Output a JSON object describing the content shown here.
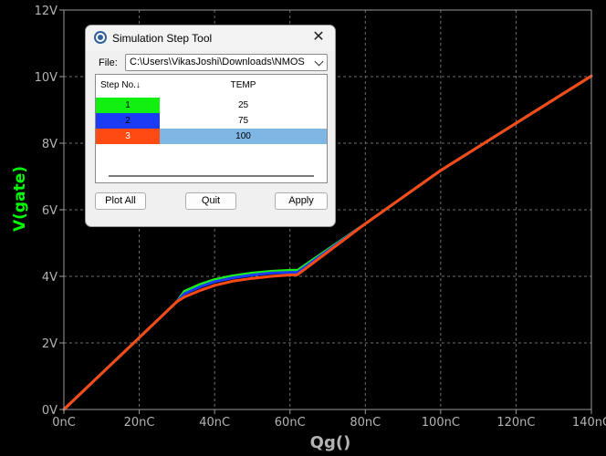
{
  "chart_data": {
    "type": "line",
    "title": "",
    "xlabel": "Qg()",
    "ylabel": "V(gate)",
    "xlim": [
      0,
      140
    ],
    "ylim": [
      0,
      12
    ],
    "x_ticks": [
      "0nC",
      "20nC",
      "40nC",
      "60nC",
      "80nC",
      "100nC",
      "120nC",
      "140nC"
    ],
    "y_ticks": [
      "0V",
      "2V",
      "4V",
      "6V",
      "8V",
      "10V",
      "12V"
    ],
    "x_tick_values": [
      0,
      20,
      40,
      60,
      80,
      100,
      120,
      140
    ],
    "y_tick_values": [
      0,
      2,
      4,
      6,
      8,
      10,
      12
    ],
    "grid": true,
    "series": [
      {
        "color": "#1cf01c",
        "x": [
          0,
          10,
          20,
          30,
          32,
          36,
          40,
          45,
          50,
          55,
          60,
          62,
          80,
          100,
          120,
          140
        ],
        "y": [
          0,
          1.08,
          2.16,
          3.24,
          3.55,
          3.75,
          3.9,
          4.02,
          4.1,
          4.15,
          4.18,
          4.18,
          5.58,
          7.18,
          8.6,
          10.02
        ]
      },
      {
        "color": "#1a3cf5",
        "x": [
          0,
          10,
          20,
          30,
          32,
          36,
          40,
          45,
          50,
          55,
          60,
          62,
          80,
          100,
          120,
          140
        ],
        "y": [
          0,
          1.08,
          2.16,
          3.24,
          3.48,
          3.68,
          3.84,
          3.96,
          4.04,
          4.1,
          4.12,
          4.12,
          5.58,
          7.18,
          8.6,
          10.02
        ]
      },
      {
        "color": "#ff4a14",
        "x": [
          0,
          10,
          20,
          30,
          32,
          36,
          40,
          45,
          50,
          55,
          60,
          62,
          80,
          100,
          120,
          140
        ],
        "y": [
          0,
          1.08,
          2.16,
          3.24,
          3.38,
          3.57,
          3.73,
          3.86,
          3.94,
          4.0,
          4.04,
          4.05,
          5.58,
          7.18,
          8.6,
          10.02
        ]
      }
    ]
  },
  "dialog": {
    "title": "Simulation Step Tool",
    "file_label": "File:",
    "file_value": "C:\\Users\\VikasJoshi\\Downloads\\NMOS Vgs vs Qg",
    "table": {
      "headers": {
        "step": "Step No.↓",
        "temp": "TEMP"
      },
      "rows": [
        {
          "step": "1",
          "temp": "25",
          "color": "#12f012",
          "text_color": "#000000",
          "selected": false
        },
        {
          "step": "2",
          "temp": "75",
          "color": "#1a3cf5",
          "text_color": "#000000",
          "selected": false
        },
        {
          "step": "3",
          "temp": "100",
          "color": "#ff4a14",
          "text_color": "#ffffff",
          "selected": true
        }
      ]
    },
    "buttons": {
      "plot_all": "Plot All",
      "quit": "Quit",
      "apply": "Apply"
    }
  }
}
